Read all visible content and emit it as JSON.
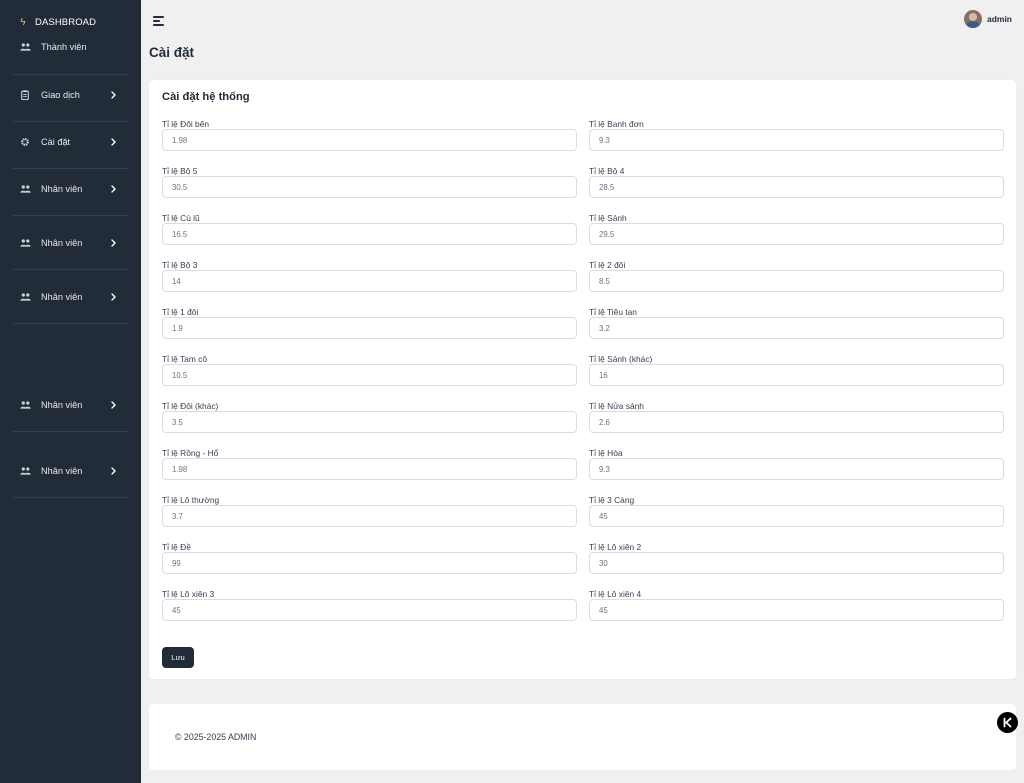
{
  "sidebar": {
    "brand": "DASHBROAD",
    "items": [
      {
        "label": "Thành viên",
        "icon": "users-icon",
        "has_chevron": false
      },
      {
        "label": "Giao dịch",
        "icon": "clipboard-icon",
        "has_chevron": true
      },
      {
        "label": "Cài đặt",
        "icon": "gear-icon",
        "has_chevron": true
      },
      {
        "label": "Nhân viên",
        "icon": "users-icon",
        "has_chevron": true
      },
      {
        "label": "Nhân viên",
        "icon": "users-icon",
        "has_chevron": true
      },
      {
        "label": "Nhân viên",
        "icon": "users-icon",
        "has_chevron": true
      },
      {
        "label": "Nhân viên",
        "icon": "users-icon",
        "has_chevron": true
      },
      {
        "label": "Nhân viên",
        "icon": "users-icon",
        "has_chevron": true
      }
    ]
  },
  "header": {
    "username": "admin"
  },
  "page": {
    "title": "Cài đặt"
  },
  "settings": {
    "title": "Cài đặt hệ thống",
    "fields": [
      {
        "label": "Tỉ lệ Đôi bên",
        "value": "1.98"
      },
      {
        "label": "Tỉ lệ Banh đơn",
        "value": "9.3"
      },
      {
        "label": "Tỉ lệ Bộ 5",
        "value": "30.5"
      },
      {
        "label": "Tỉ lệ Bộ 4",
        "value": "28.5"
      },
      {
        "label": "Tỉ lệ Cù lũ",
        "value": "16.5"
      },
      {
        "label": "Tỉ lệ Sảnh",
        "value": "29.5"
      },
      {
        "label": "Tỉ lệ Bộ 3",
        "value": "14"
      },
      {
        "label": "Tỉ lệ 2 đôi",
        "value": "8.5"
      },
      {
        "label": "Tỉ lệ 1 đôi",
        "value": "1.9"
      },
      {
        "label": "Tỉ lệ Tiêu tan",
        "value": "3.2"
      },
      {
        "label": "Tỉ lệ Tam cô",
        "value": "10.5"
      },
      {
        "label": "Tỉ lệ Sảnh (khác)",
        "value": "16"
      },
      {
        "label": "Tỉ lệ Đôi (khác)",
        "value": "3.5"
      },
      {
        "label": "Tỉ lệ Nửa sảnh",
        "value": "2.6"
      },
      {
        "label": "Tỉ lệ Rồng - Hổ",
        "value": "1.98"
      },
      {
        "label": "Tỉ lệ Hòa",
        "value": "9.3"
      },
      {
        "label": "Tỉ lệ Lô thường",
        "value": "3.7"
      },
      {
        "label": "Tỉ lệ 3 Càng",
        "value": "45"
      },
      {
        "label": "Tỉ lệ Đề",
        "value": "99"
      },
      {
        "label": "Tỉ lệ Lô xiên 2",
        "value": "30"
      },
      {
        "label": "Tỉ lệ Lô xiên 3",
        "value": "45"
      },
      {
        "label": "Tỉ lệ Lô xiên 4",
        "value": "45"
      }
    ],
    "save_label": "Lưu"
  },
  "footer": {
    "copyright": "© 2025-2025 ADMIN"
  },
  "fab": {
    "icon": "k-logo-icon"
  }
}
